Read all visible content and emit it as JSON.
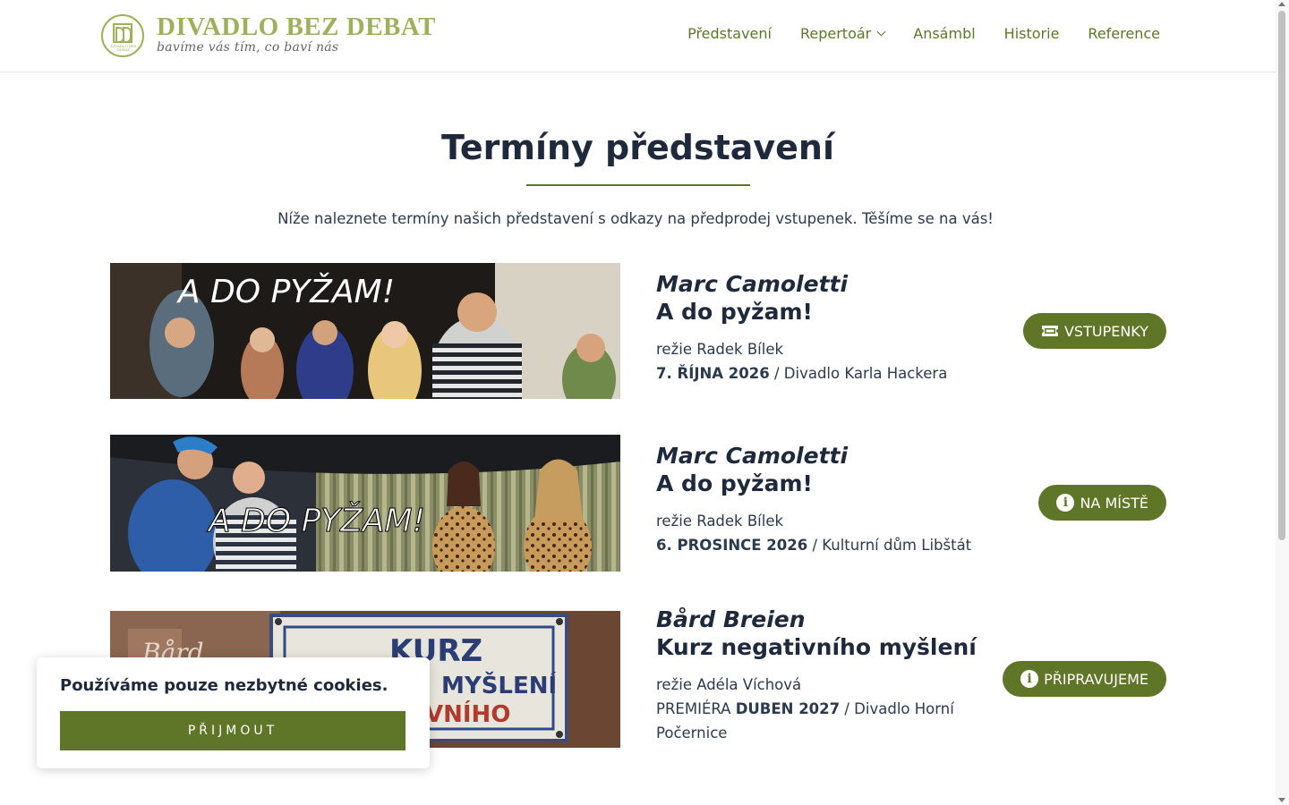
{
  "header": {
    "logo_title": "DIVADLO BEZ DEBAT",
    "logo_tagline": "bavíme vás tím, co baví nás",
    "logo_emblem_text": "DIVADLO BEZ DEBAT",
    "nav": [
      {
        "label": "Představení"
      },
      {
        "label": "Repertoár"
      },
      {
        "label": "Ansámbl"
      },
      {
        "label": "Historie"
      },
      {
        "label": "Reference"
      }
    ]
  },
  "main": {
    "title": "Termíny představení",
    "intro": "Níže naleznete termíny našich představení s odkazy na předprodej vstupenek. Těšíme se na vás!",
    "events": [
      {
        "image_text": "A DO PYŽAM!",
        "author": "Marc Camoletti",
        "play": "A do pyžam!",
        "director": "režie Radek Bílek",
        "prefix": "",
        "date": "7. ŘÍJNA 2026",
        "venue": " / Divadlo Karla Hackera",
        "button": "VSTUPENKY",
        "button_icon": "ticket-icon"
      },
      {
        "image_text": "A DO PYŽAM!",
        "author": "Marc Camoletti",
        "play": "A do pyžam!",
        "director": "režie Radek Bílek",
        "prefix": "",
        "date": "6. PROSINCE 2026",
        "venue": " / Kulturní dům Libštát",
        "button": "NA MÍSTĚ",
        "button_icon": "info-icon"
      },
      {
        "image_text_top": "KURZ",
        "image_text_mid": "MYŠLENÍ",
        "image_text_bot": "VNÍHO",
        "image_text_left": "Bård",
        "author": "Bård Breien",
        "play": "Kurz negativního myšlení",
        "director": "režie Adéla Víchová",
        "prefix": "PREMIÉRA ",
        "date": "DUBEN 2027",
        "venue": " / Divadlo Horní Počernice",
        "button": "PŘIPRAVUJEME",
        "button_icon": "info-icon"
      }
    ]
  },
  "cookie": {
    "message": "Používáme pouze nezbytné cookies.",
    "accept": "PŘIJMOUT"
  },
  "colors": {
    "accent": "#5f7527",
    "logo": "#9fb05a",
    "heading": "#1e2a3b"
  }
}
